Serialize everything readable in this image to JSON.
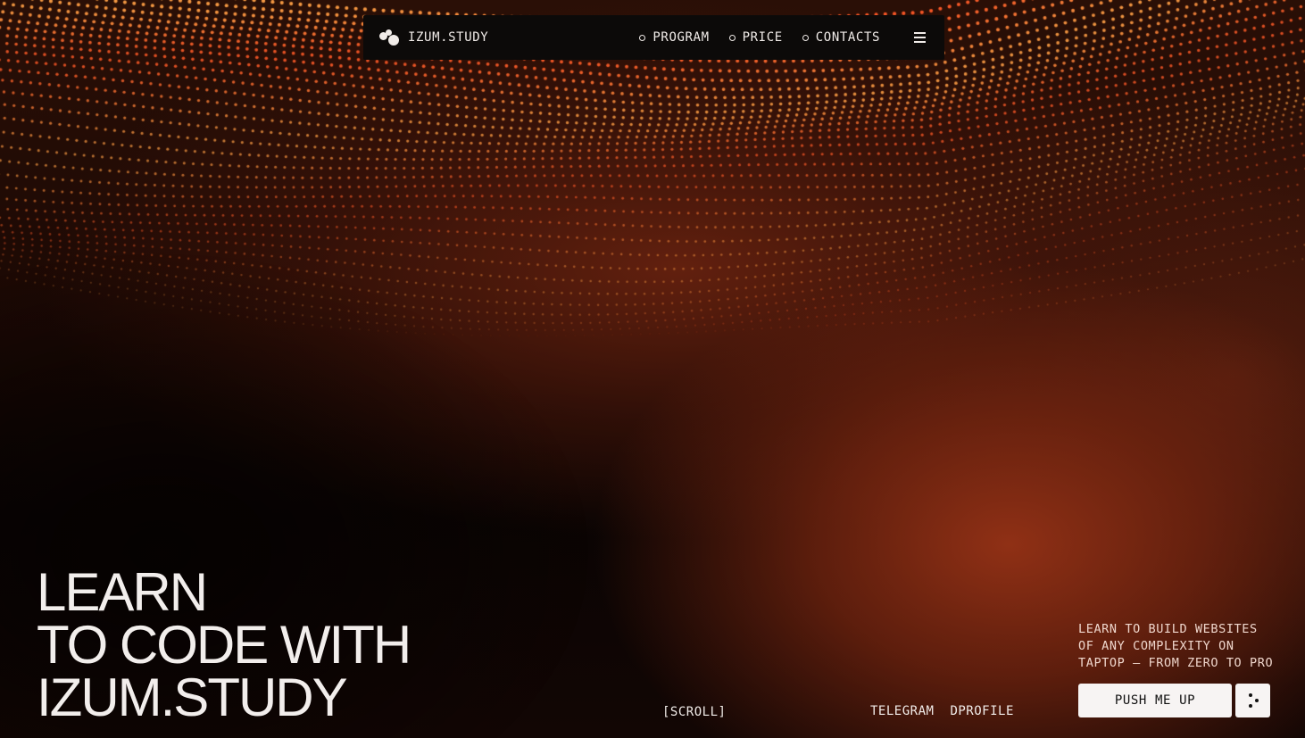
{
  "nav": {
    "brand": "IZUM.STUDY",
    "links": [
      {
        "label": "PROGRAM"
      },
      {
        "label": "PRICE"
      },
      {
        "label": "CONTACTS"
      }
    ]
  },
  "hero": {
    "title_lines": [
      "LEARN",
      "TO CODE WITH",
      "IZUM.STUDY"
    ],
    "scroll_hint": "[SCROLL]",
    "tagline_lines": [
      "LEARN TO BUILD WEBSITES",
      "OF ANY COMPLEXITY ON",
      "TAPTOP — FROM ZERO TO PRO"
    ],
    "cta_label": "PUSH ME UP"
  },
  "social": {
    "links": [
      {
        "label": "TELEGRAM"
      },
      {
        "label": "DPROFILE"
      }
    ]
  },
  "colors": {
    "accent": "#ff6a3d",
    "background": "#060302",
    "text": "#f1ece9"
  }
}
